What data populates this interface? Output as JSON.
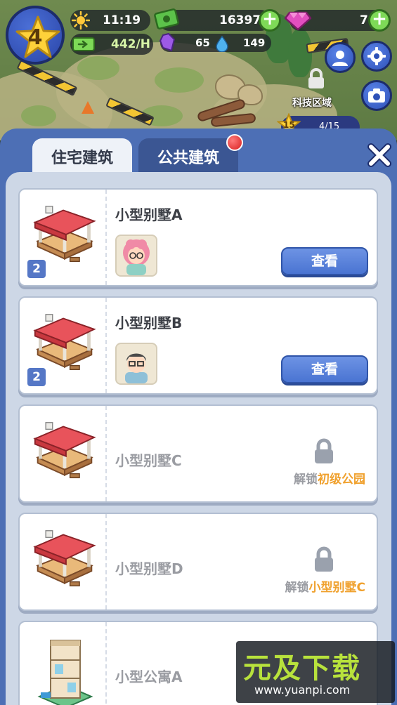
{
  "hud": {
    "level": "4",
    "time": "11:19",
    "income_rate": "442/H",
    "cash": "16397",
    "gems": "7",
    "crystal": "65",
    "water": "149"
  },
  "map": {
    "zone_label": "科技区域",
    "zone_level": "15",
    "zone_progress": "4/15"
  },
  "tabs": [
    {
      "label": "住宅建筑",
      "active": true
    },
    {
      "label": "公共建筑",
      "active": false,
      "notification": true
    }
  ],
  "buildings": [
    {
      "name": "小型别墅A",
      "count": "2",
      "status": "unlocked",
      "action_label": "查看",
      "resident": "girl"
    },
    {
      "name": "小型别墅B",
      "count": "2",
      "status": "unlocked",
      "action_label": "查看",
      "resident": "man"
    },
    {
      "name": "小型别墅C",
      "status": "locked",
      "unlock_prefix": "解锁",
      "unlock_target": "初级公园"
    },
    {
      "name": "小型别墅D",
      "status": "locked",
      "unlock_prefix": "解锁",
      "unlock_target": "小型别墅C"
    },
    {
      "name": "小型公寓A",
      "status": "locked"
    }
  ],
  "watermark": {
    "brand": "元及下载",
    "url": "www.yuanpi.com"
  },
  "colors": {
    "panel": "#4d6fb5",
    "button": "#4a74d2",
    "highlight": "#f0a12e",
    "plus": "#7ed957"
  }
}
